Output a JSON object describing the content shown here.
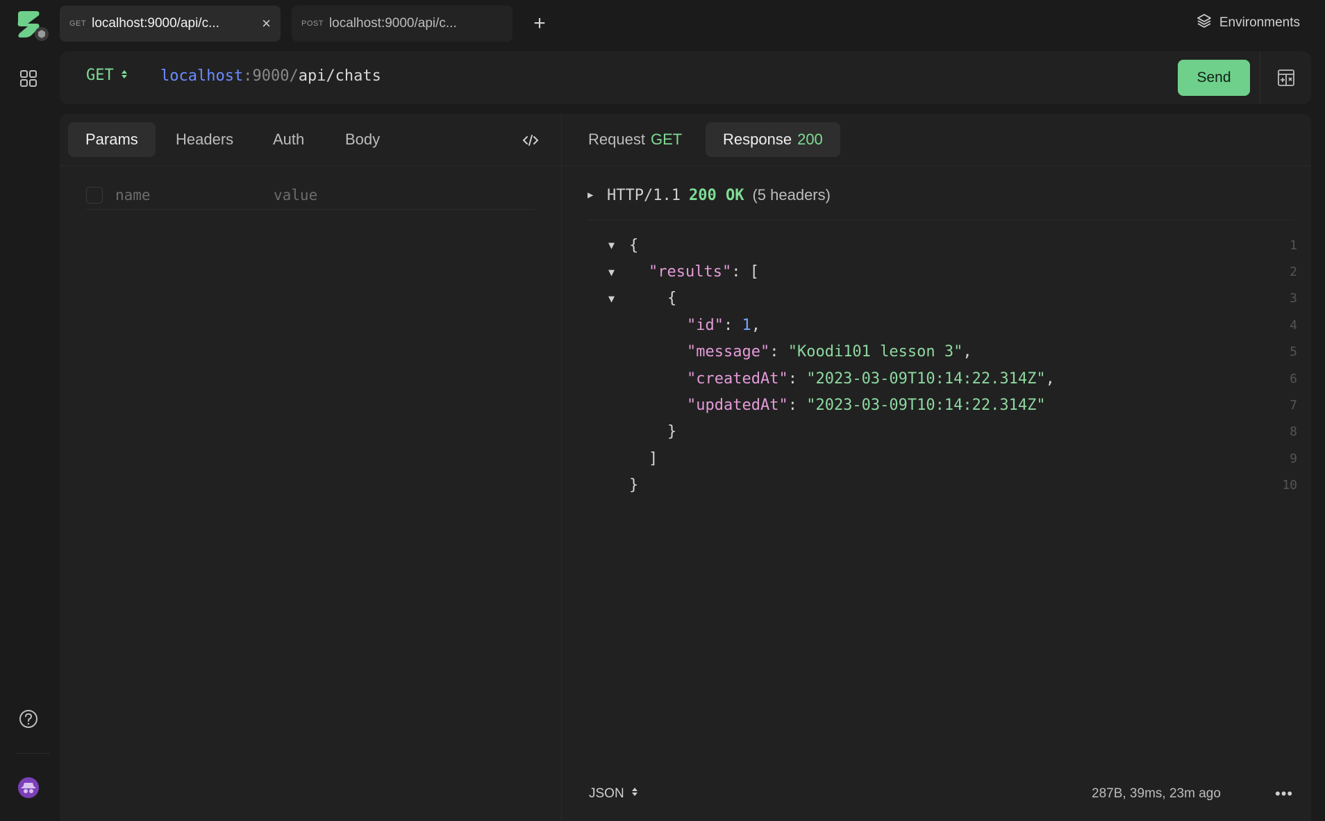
{
  "tabs": [
    {
      "method": "GET",
      "title": "localhost:9000/api/c...",
      "close": "×"
    },
    {
      "method": "POST",
      "title": "localhost:9000/api/c..."
    }
  ],
  "new_tab": "+",
  "environments_label": "Environments",
  "request": {
    "method": "GET",
    "url_host": "localhost",
    "url_port": ":9000/",
    "url_path": "api/chats",
    "send_label": "Send"
  },
  "left_tabs": [
    "Params",
    "Headers",
    "Auth",
    "Body"
  ],
  "params": {
    "name_placeholder": "name",
    "value_placeholder": "value"
  },
  "right_tabs": {
    "request_label": "Request",
    "request_method": "GET",
    "response_label": "Response",
    "response_status": "200"
  },
  "response": {
    "http_version": "HTTP/1.1",
    "status": "200 OK",
    "headers_count": "(5 headers)",
    "lines": [
      {
        "n": "1",
        "fold": "▼"
      },
      {
        "n": "2",
        "fold": "▼"
      },
      {
        "n": "3",
        "fold": "▼"
      },
      {
        "n": "4"
      },
      {
        "n": "5"
      },
      {
        "n": "6"
      },
      {
        "n": "7"
      },
      {
        "n": "8"
      },
      {
        "n": "9"
      },
      {
        "n": "10"
      }
    ],
    "body": {
      "results_key": "\"results\"",
      "id_key": "\"id\"",
      "id_val": "1",
      "message_key": "\"message\"",
      "message_val": "\"Koodi101 lesson 3\"",
      "createdAt_key": "\"createdAt\"",
      "createdAt_val": "\"2023-03-09T10:14:22.314Z\"",
      "updatedAt_key": "\"updatedAt\"",
      "updatedAt_val": "\"2023-03-09T10:14:22.314Z\""
    },
    "format": "JSON",
    "meta": "287B, 39ms, 23m ago",
    "more": "•••"
  },
  "icons": {
    "logo": "app-logo",
    "collections": "grid-icon",
    "help": "help-circle-icon",
    "user": "incognito-avatar-icon",
    "layers": "layers-icon",
    "code": "code-icon",
    "layout": "layout-toggle-icon"
  },
  "colors": {
    "accent": "#6ed08a",
    "host": "#6c8cff",
    "json_key": "#e49bd9",
    "json_string": "#8ed8a0",
    "json_number": "#78a6ff"
  }
}
